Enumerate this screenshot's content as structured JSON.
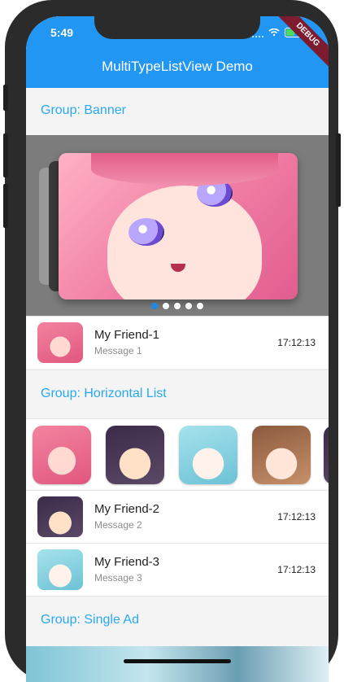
{
  "status_bar": {
    "time": "5:49"
  },
  "app_bar": {
    "title": "MultiTypeListView Demo",
    "debug_banner": "DEBUG"
  },
  "groups": {
    "banner": "Group: Banner",
    "horizontal": "Group: Horizontal List",
    "single_ad": "Group: Single Ad"
  },
  "banner": {
    "page_count": 5,
    "active_index": 0
  },
  "friends": [
    {
      "name": "My Friend-1",
      "message": "Message 1",
      "time": "17:12:13",
      "avatar": "pink-haired-girl-avatar"
    },
    {
      "name": "My Friend-2",
      "message": "Message 2",
      "time": "17:12:13",
      "avatar": "dark-haired-boy-avatar"
    },
    {
      "name": "My Friend-3",
      "message": "Message 3",
      "time": "17:12:13",
      "avatar": "teal-haired-boy-avatar"
    }
  ],
  "horizontal_items": [
    "pink-haired-girl",
    "dark-haired-boy",
    "teal-haired-boy",
    "brown-haired-girl"
  ],
  "colors": {
    "primary": "#2196f3",
    "group_text": "#2aa8f2",
    "active_dot": "#1e88e5"
  }
}
